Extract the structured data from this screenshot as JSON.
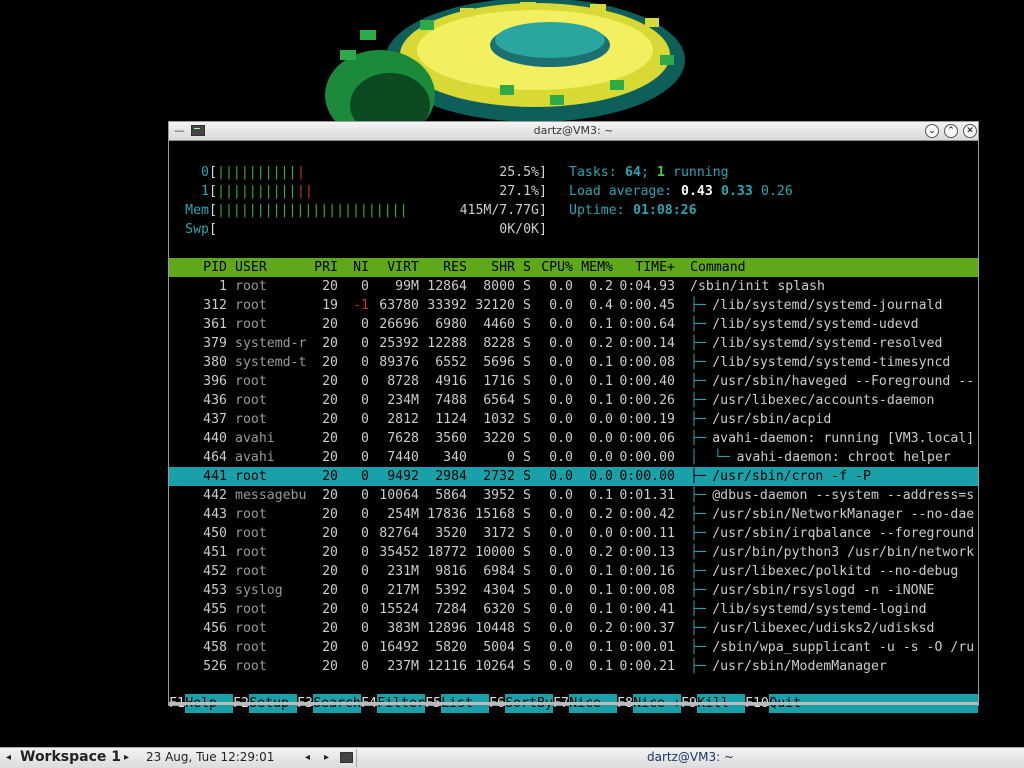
{
  "window": {
    "title": "dartz@VM3: ~",
    "menu_glyph": "—"
  },
  "meters": {
    "cpu0": {
      "label": "0",
      "bars_green": "||||||||||",
      "bars_red": "|",
      "value": "25.5%"
    },
    "cpu1": {
      "label": "1",
      "bars_green": "||||||||||",
      "bars_red": "||",
      "value": "27.1%"
    },
    "mem": {
      "label": "Mem",
      "bars_green": "||||||||||||||||||||||||",
      "value": "415M/7.77G"
    },
    "swp": {
      "label": "Swp",
      "bars_green": "",
      "value": "0K/0K"
    },
    "tasks": {
      "label": "Tasks:",
      "count": "64",
      "sep": ";",
      "running": "1",
      "running_label": "running"
    },
    "load": {
      "label": "Load average:",
      "v1": "0.43",
      "v2": "0.33",
      "v3": "0.26"
    },
    "uptime": {
      "label": "Uptime:",
      "value": "01:08:26"
    }
  },
  "columns": [
    "PID",
    "USER",
    "PRI",
    "NI",
    "VIRT",
    "RES",
    "SHR",
    "S",
    "CPU%",
    "MEM%",
    "TIME+",
    "Command"
  ],
  "processes": [
    {
      "pid": "1",
      "user": "root",
      "pri": "20",
      "ni": "0",
      "virt": "99M",
      "res": "12864",
      "shr": "8000",
      "s": "S",
      "cpu": "0.0",
      "mem": "0.2",
      "time": "0:04.93",
      "tree": "",
      "cmd": "/sbin/init splash"
    },
    {
      "pid": "312",
      "user": "root",
      "pri": "19",
      "ni": "-1",
      "virt": "63780",
      "res": "33392",
      "shr": "32120",
      "s": "S",
      "cpu": "0.0",
      "mem": "0.4",
      "time": "0:00.45",
      "tree": "├─",
      "cmd": "/lib/systemd/systemd-journald"
    },
    {
      "pid": "361",
      "user": "root",
      "pri": "20",
      "ni": "0",
      "virt": "26696",
      "res": "6980",
      "shr": "4460",
      "s": "S",
      "cpu": "0.0",
      "mem": "0.1",
      "time": "0:00.64",
      "tree": "├─",
      "cmd": "/lib/systemd/systemd-udevd"
    },
    {
      "pid": "379",
      "user": "systemd-r",
      "pri": "20",
      "ni": "0",
      "virt": "25392",
      "res": "12288",
      "shr": "8228",
      "s": "S",
      "cpu": "0.0",
      "mem": "0.2",
      "time": "0:00.14",
      "tree": "├─",
      "cmd": "/lib/systemd/systemd-resolved"
    },
    {
      "pid": "380",
      "user": "systemd-t",
      "pri": "20",
      "ni": "0",
      "virt": "89376",
      "res": "6552",
      "shr": "5696",
      "s": "S",
      "cpu": "0.0",
      "mem": "0.1",
      "time": "0:00.08",
      "tree": "├─",
      "cmd": "/lib/systemd/systemd-timesyncd"
    },
    {
      "pid": "396",
      "user": "root",
      "pri": "20",
      "ni": "0",
      "virt": "8728",
      "res": "4916",
      "shr": "1716",
      "s": "S",
      "cpu": "0.0",
      "mem": "0.1",
      "time": "0:00.40",
      "tree": "├─",
      "cmd": "/usr/sbin/haveged --Foreground --"
    },
    {
      "pid": "436",
      "user": "root",
      "pri": "20",
      "ni": "0",
      "virt": "234M",
      "res": "7488",
      "shr": "6564",
      "s": "S",
      "cpu": "0.0",
      "mem": "0.1",
      "time": "0:00.26",
      "tree": "├─",
      "cmd": "/usr/libexec/accounts-daemon"
    },
    {
      "pid": "437",
      "user": "root",
      "pri": "20",
      "ni": "0",
      "virt": "2812",
      "res": "1124",
      "shr": "1032",
      "s": "S",
      "cpu": "0.0",
      "mem": "0.0",
      "time": "0:00.19",
      "tree": "├─",
      "cmd": "/usr/sbin/acpid"
    },
    {
      "pid": "440",
      "user": "avahi",
      "pri": "20",
      "ni": "0",
      "virt": "7628",
      "res": "3560",
      "shr": "3220",
      "s": "S",
      "cpu": "0.0",
      "mem": "0.0",
      "time": "0:00.06",
      "tree": "├─",
      "cmd": "avahi-daemon: running [VM3.local]"
    },
    {
      "pid": "464",
      "user": "avahi",
      "pri": "20",
      "ni": "0",
      "virt": "7440",
      "res": "340",
      "shr": "0",
      "s": "S",
      "cpu": "0.0",
      "mem": "0.0",
      "time": "0:00.00",
      "tree": "│  └─",
      "cmd": "avahi-daemon: chroot helper"
    },
    {
      "pid": "441",
      "user": "root",
      "pri": "20",
      "ni": "0",
      "virt": "9492",
      "res": "2984",
      "shr": "2732",
      "s": "S",
      "cpu": "0.0",
      "mem": "0.0",
      "time": "0:00.00",
      "tree": "├─",
      "cmd": "/usr/sbin/cron -f -P"
    },
    {
      "pid": "442",
      "user": "messagebu",
      "pri": "20",
      "ni": "0",
      "virt": "10064",
      "res": "5864",
      "shr": "3952",
      "s": "S",
      "cpu": "0.0",
      "mem": "0.1",
      "time": "0:01.31",
      "tree": "├─",
      "cmd": "@dbus-daemon --system --address=s"
    },
    {
      "pid": "443",
      "user": "root",
      "pri": "20",
      "ni": "0",
      "virt": "254M",
      "res": "17836",
      "shr": "15168",
      "s": "S",
      "cpu": "0.0",
      "mem": "0.2",
      "time": "0:00.42",
      "tree": "├─",
      "cmd": "/usr/sbin/NetworkManager --no-dae"
    },
    {
      "pid": "450",
      "user": "root",
      "pri": "20",
      "ni": "0",
      "virt": "82764",
      "res": "3520",
      "shr": "3172",
      "s": "S",
      "cpu": "0.0",
      "mem": "0.0",
      "time": "0:00.11",
      "tree": "├─",
      "cmd": "/usr/sbin/irqbalance --foreground"
    },
    {
      "pid": "451",
      "user": "root",
      "pri": "20",
      "ni": "0",
      "virt": "35452",
      "res": "18772",
      "shr": "10000",
      "s": "S",
      "cpu": "0.0",
      "mem": "0.2",
      "time": "0:00.13",
      "tree": "├─",
      "cmd": "/usr/bin/python3 /usr/bin/network"
    },
    {
      "pid": "452",
      "user": "root",
      "pri": "20",
      "ni": "0",
      "virt": "231M",
      "res": "9816",
      "shr": "6984",
      "s": "S",
      "cpu": "0.0",
      "mem": "0.1",
      "time": "0:00.16",
      "tree": "├─",
      "cmd": "/usr/libexec/polkitd --no-debug"
    },
    {
      "pid": "453",
      "user": "syslog",
      "pri": "20",
      "ni": "0",
      "virt": "217M",
      "res": "5392",
      "shr": "4304",
      "s": "S",
      "cpu": "0.0",
      "mem": "0.1",
      "time": "0:00.08",
      "tree": "├─",
      "cmd": "/usr/sbin/rsyslogd -n -iNONE"
    },
    {
      "pid": "455",
      "user": "root",
      "pri": "20",
      "ni": "0",
      "virt": "15524",
      "res": "7284",
      "shr": "6320",
      "s": "S",
      "cpu": "0.0",
      "mem": "0.1",
      "time": "0:00.41",
      "tree": "├─",
      "cmd": "/lib/systemd/systemd-logind"
    },
    {
      "pid": "456",
      "user": "root",
      "pri": "20",
      "ni": "0",
      "virt": "383M",
      "res": "12896",
      "shr": "10448",
      "s": "S",
      "cpu": "0.0",
      "mem": "0.2",
      "time": "0:00.37",
      "tree": "├─",
      "cmd": "/usr/libexec/udisks2/udisksd"
    },
    {
      "pid": "458",
      "user": "root",
      "pri": "20",
      "ni": "0",
      "virt": "16492",
      "res": "5820",
      "shr": "5004",
      "s": "S",
      "cpu": "0.0",
      "mem": "0.1",
      "time": "0:00.01",
      "tree": "├─",
      "cmd": "/sbin/wpa_supplicant -u -s -O /ru"
    },
    {
      "pid": "526",
      "user": "root",
      "pri": "20",
      "ni": "0",
      "virt": "237M",
      "res": "12116",
      "shr": "10264",
      "s": "S",
      "cpu": "0.0",
      "mem": "0.1",
      "time": "0:00.21",
      "tree": "├─",
      "cmd": "/usr/sbin/ModemManager"
    }
  ],
  "selected_pid": "441",
  "fkeys": [
    {
      "key": "F1",
      "label": "Help"
    },
    {
      "key": "F2",
      "label": "Setup"
    },
    {
      "key": "F3",
      "label": "Search"
    },
    {
      "key": "F4",
      "label": "Filter"
    },
    {
      "key": "F5",
      "label": "List"
    },
    {
      "key": "F6",
      "label": "SortBy"
    },
    {
      "key": "F7",
      "label": "Nice -"
    },
    {
      "key": "F8",
      "label": "Nice +"
    },
    {
      "key": "F9",
      "label": "Kill"
    },
    {
      "key": "F10",
      "label": "Quit"
    }
  ],
  "taskbar": {
    "workspace_label": "Workspace 1",
    "clock": "23 Aug, Tue 12:29:01",
    "window_title": "dartz@VM3: ~",
    "arrow_left": "◂",
    "arrow_right": "▸"
  },
  "colors": {
    "header_bg": "#5fa81a",
    "selected_bg": "#1aa0a8",
    "cyan": "#2aa5b0"
  }
}
